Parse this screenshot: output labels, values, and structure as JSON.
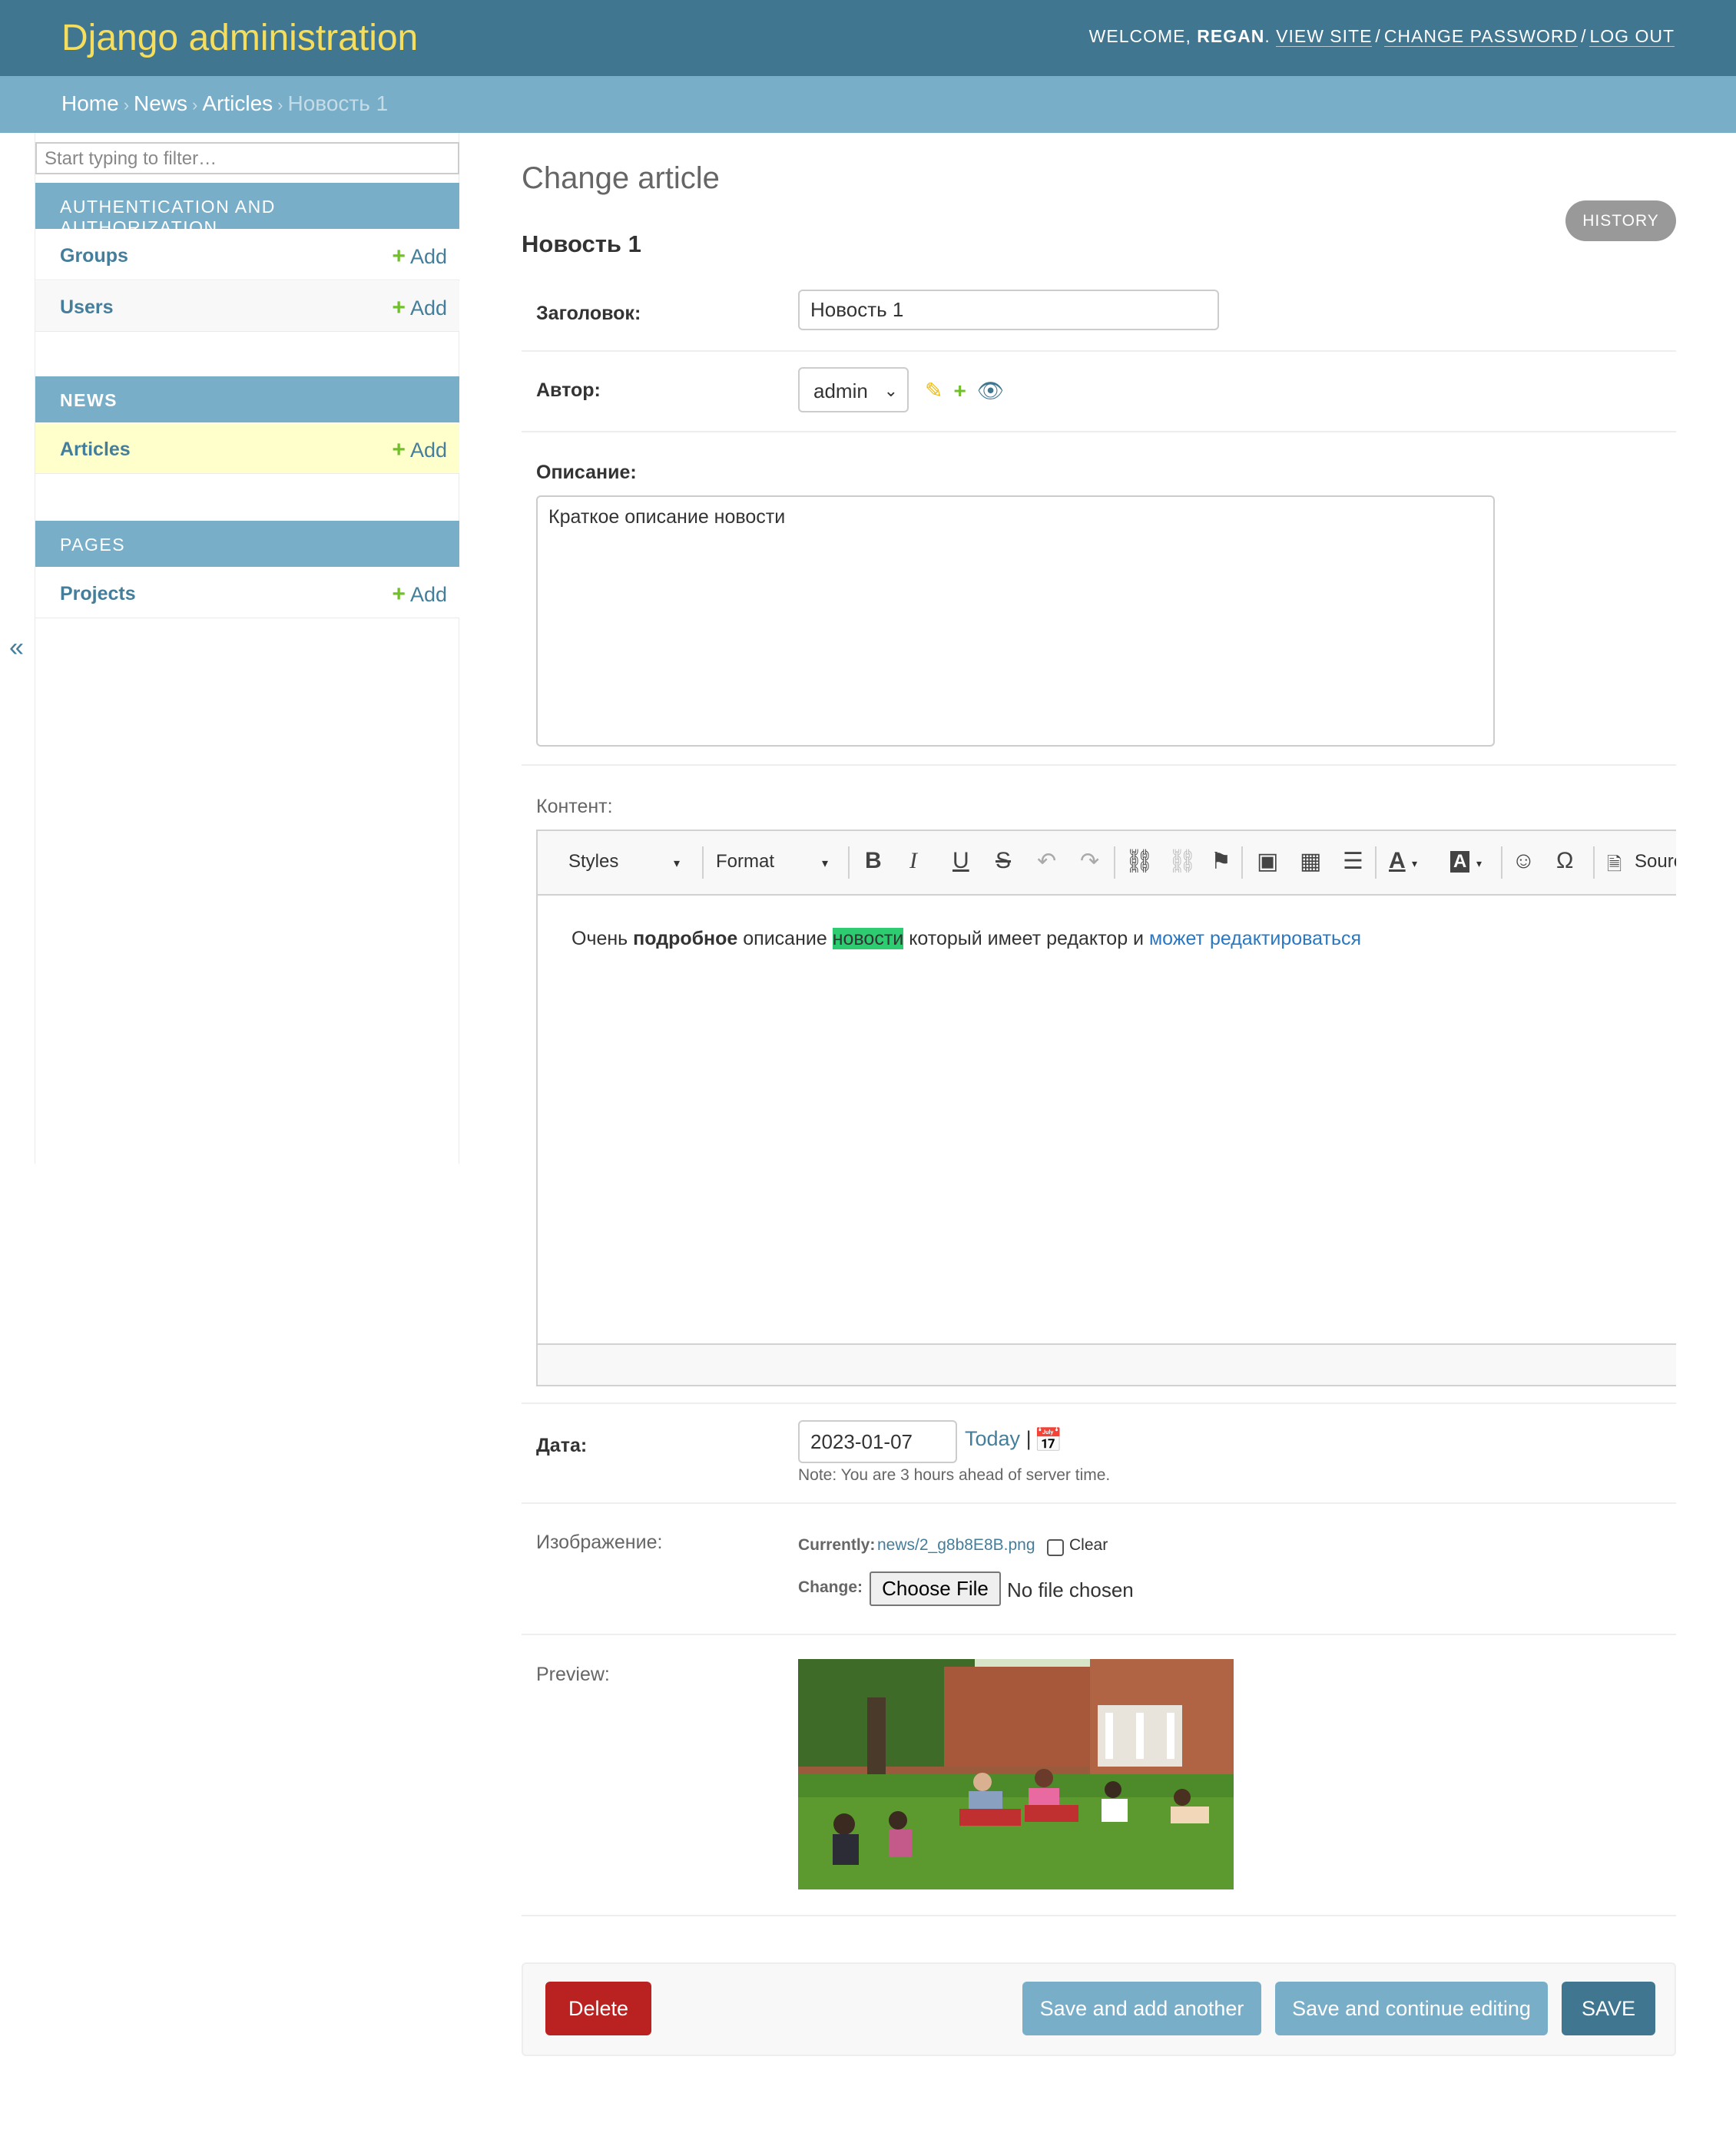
{
  "header": {
    "brand": "Django administration",
    "welcome": "WELCOME, ",
    "username": "REGAN",
    "view_site": "VIEW SITE",
    "change_password": "CHANGE PASSWORD",
    "log_out": "LOG OUT"
  },
  "breadcrumbs": {
    "items": [
      "Home",
      "News",
      "Articles"
    ],
    "current": "Новость 1"
  },
  "sidebar": {
    "filter_placeholder": "Start typing to filter…",
    "add_label": "Add",
    "collapse_glyph": "«",
    "modules": [
      {
        "name": "AUTHENTICATION AND AUTHORIZATION",
        "items": [
          "Groups",
          "Users"
        ]
      },
      {
        "name": "NEWS",
        "items": [
          "Articles"
        ]
      },
      {
        "name": "PAGES",
        "items": [
          "Projects"
        ]
      }
    ]
  },
  "content": {
    "title": "Change article",
    "history": "HISTORY",
    "object_title": "Новость 1",
    "fields": {
      "title_label": "Заголовок:",
      "title_value": "Новость 1",
      "author_label": "Автор:",
      "author_value": "admin",
      "description_label": "Описание:",
      "description_value": "Краткое описание новости",
      "content_label": "Контент:",
      "date_label": "Дата:",
      "date_value": "2023-01-07",
      "today": "Today",
      "date_sep": "|",
      "date_note": "Note: You are 3 hours ahead of server time.",
      "image_label": "Изображение:",
      "currently_label": "Currently:",
      "current_file": "news/2_g8b8E8B.png",
      "clear_label": "Clear",
      "change_label": "Change:",
      "choose_file": "Choose File",
      "no_file": "No file chosen",
      "preview_label": "Preview:"
    },
    "editor": {
      "styles": "Styles",
      "format": "Format",
      "source": "Source",
      "text_before": "Очень ",
      "text_bold": "подробное",
      "text_mid": " описание ",
      "text_highlight": "новости",
      "text_after": " который имеет редактор и ",
      "text_link": "может редактироваться"
    }
  },
  "submit": {
    "delete": "Delete",
    "save_add": "Save and add another",
    "save_continue": "Save and continue editing",
    "save": "SAVE"
  },
  "colors": {
    "header_bg": "#417690",
    "brand": "#f5dd5d",
    "breadcrumb_bg": "#79aec8",
    "link": "#447e9b",
    "delete": "#ba2121",
    "highlight": "#2ecc71"
  }
}
